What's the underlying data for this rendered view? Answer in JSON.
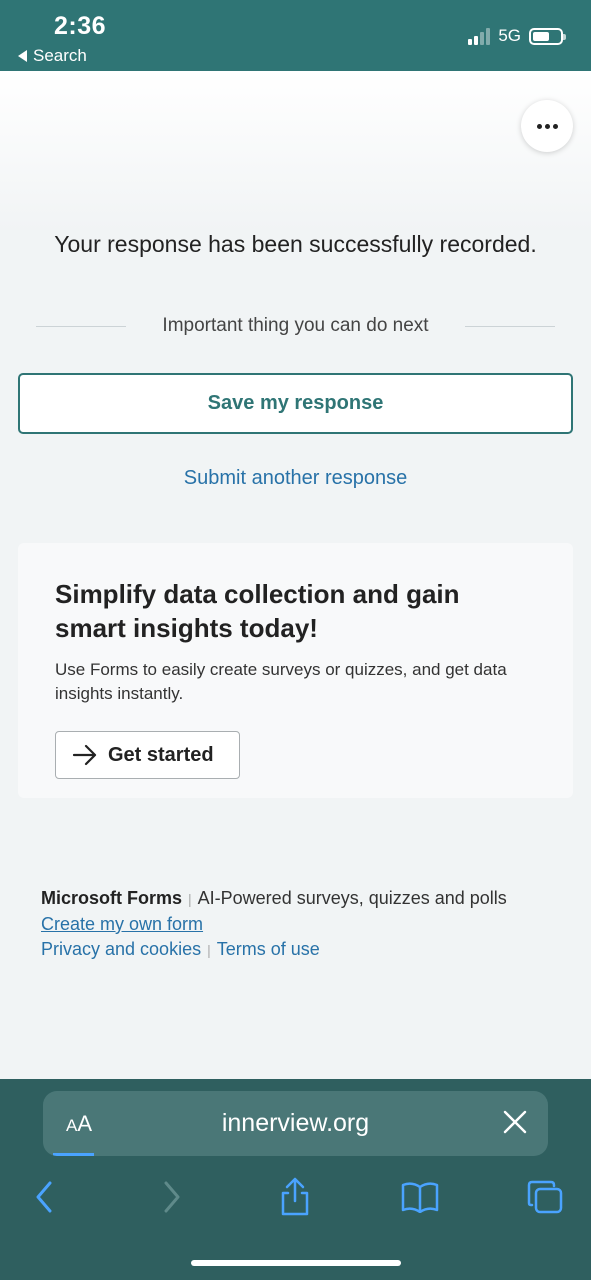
{
  "status_bar": {
    "time": "2:36",
    "back_label": "Search",
    "network": "5G"
  },
  "page": {
    "success_message": "Your response has been successfully recorded.",
    "next_heading": "Important thing you can do next",
    "save_button": "Save my response",
    "submit_another": "Submit another response",
    "promo": {
      "title": "Simplify data collection and gain smart insights today!",
      "description": "Use Forms to easily create surveys or quizzes, and get data insights instantly.",
      "button": "Get started"
    },
    "footer": {
      "brand": "Microsoft Forms",
      "separator": "|",
      "tagline": "AI-Powered surveys, quizzes and polls",
      "create_link": "Create my own form",
      "privacy": "Privacy and cookies",
      "terms": "Terms of use"
    }
  },
  "browser": {
    "aa_small": "A",
    "aa_large": "A",
    "url": "innerview.org"
  },
  "colors": {
    "accent": "#2f7575",
    "link": "#2872a8",
    "chrome": "#2f5f5f",
    "ios_blue": "#4aa3ff"
  }
}
